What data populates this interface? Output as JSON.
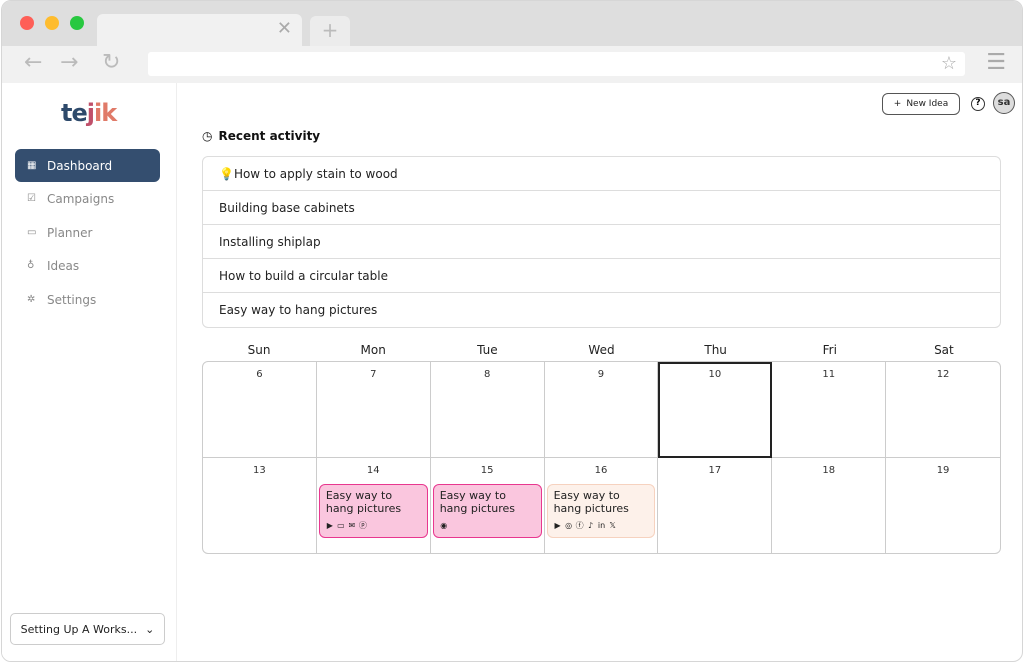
{
  "browser": {
    "close_tab": "✕",
    "new_tab": "+",
    "back": "←",
    "forward": "→",
    "reload": "↻",
    "bookmark": "☆",
    "menu": "☰"
  },
  "sidebar": {
    "logo": "tejik",
    "items": [
      {
        "label": "Dashboard",
        "icon": "dashboard-icon",
        "glyph": "▦"
      },
      {
        "label": "Campaigns",
        "icon": "campaigns-icon",
        "glyph": "☑"
      },
      {
        "label": "Planner",
        "icon": "calendar-icon",
        "glyph": "▭"
      },
      {
        "label": "Ideas",
        "icon": "lightbulb-icon",
        "glyph": "♁"
      },
      {
        "label": "Settings",
        "icon": "gear-icon",
        "glyph": "✲"
      }
    ],
    "workspace": "Setting Up A Works...",
    "workspace_chevron": "⌄"
  },
  "header": {
    "new_idea": "New Idea",
    "new_idea_icon": "+",
    "help": "?",
    "avatar": "sa"
  },
  "recent": {
    "title": "Recent activity",
    "icon": "◷",
    "items": [
      "💡How to apply stain to wood",
      "Building base cabinets",
      "Installing shiplap",
      "How to build a circular table",
      "Easy way to hang pictures"
    ]
  },
  "calendar": {
    "days": [
      "Sun",
      "Mon",
      "Tue",
      "Wed",
      "Thu",
      "Fri",
      "Sat"
    ],
    "dates": [
      "6",
      "7",
      "8",
      "9",
      "10",
      "11",
      "12",
      "13",
      "14",
      "15",
      "16",
      "17",
      "18",
      "19"
    ],
    "today": "10",
    "events": [
      {
        "date": "14",
        "title": "Easy way to hang pictures",
        "style": "pink",
        "icons": [
          "youtube",
          "laptop",
          "email",
          "pinterest"
        ],
        "glyphs": [
          "▶",
          "▭",
          "✉",
          "ⓟ"
        ]
      },
      {
        "date": "15",
        "title": "Easy way to hang pictures",
        "style": "pink",
        "icons": [
          "podcast"
        ],
        "glyphs": [
          "◉"
        ]
      },
      {
        "date": "16",
        "title": "Easy way to hang pictures",
        "style": "peach",
        "icons": [
          "youtube",
          "instagram",
          "facebook",
          "tiktok",
          "linkedin",
          "x"
        ],
        "glyphs": [
          "▶",
          "◎",
          "ⓕ",
          "♪",
          "in",
          "𝕏"
        ]
      }
    ]
  },
  "colors": {
    "accent": "#344e6f",
    "event_pink": "#fac6de",
    "event_pink_border": "#e8378f",
    "event_peach": "#fdf1ea"
  }
}
